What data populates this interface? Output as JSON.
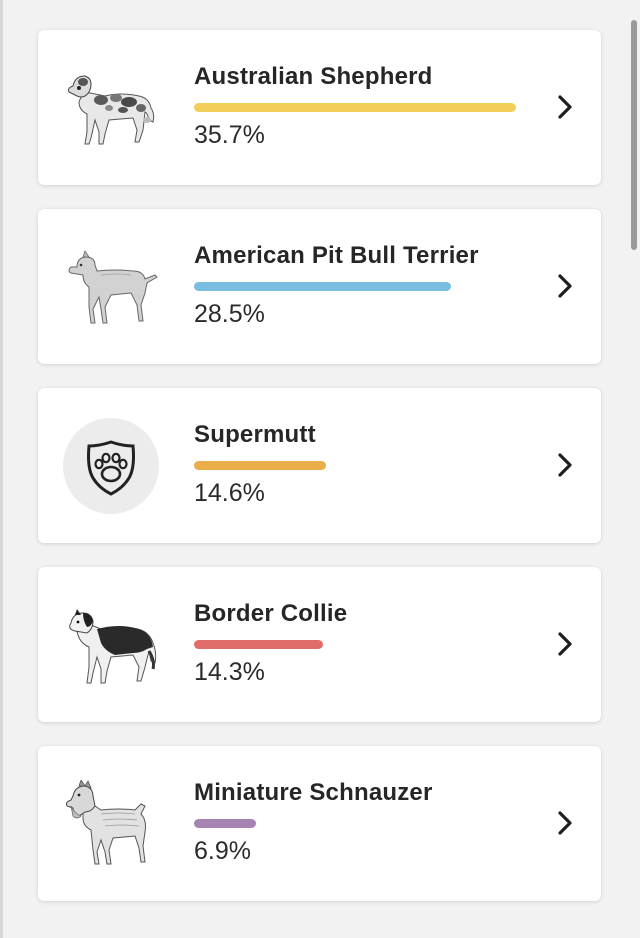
{
  "breeds": [
    {
      "name": "Australian Shepherd",
      "percent": "35.7%",
      "value": 35.7,
      "bar_color": "#f1cf5a",
      "icon": "australian-shepherd-illustration"
    },
    {
      "name": "American Pit Bull Terrier",
      "percent": "28.5%",
      "value": 28.5,
      "bar_color": "#79bde0",
      "icon": "pit-bull-terrier-illustration"
    },
    {
      "name": "Supermutt",
      "percent": "14.6%",
      "value": 14.6,
      "bar_color": "#e9ad4a",
      "icon": "paw-shield-icon"
    },
    {
      "name": "Border Collie",
      "percent": "14.3%",
      "value": 14.3,
      "bar_color": "#e06c6c",
      "icon": "border-collie-illustration"
    },
    {
      "name": "Miniature Schnauzer",
      "percent": "6.9%",
      "value": 6.9,
      "bar_color": "#a783b4",
      "icon": "miniature-schnauzer-illustration"
    }
  ],
  "chevron_icon": "chevron-right-icon"
}
